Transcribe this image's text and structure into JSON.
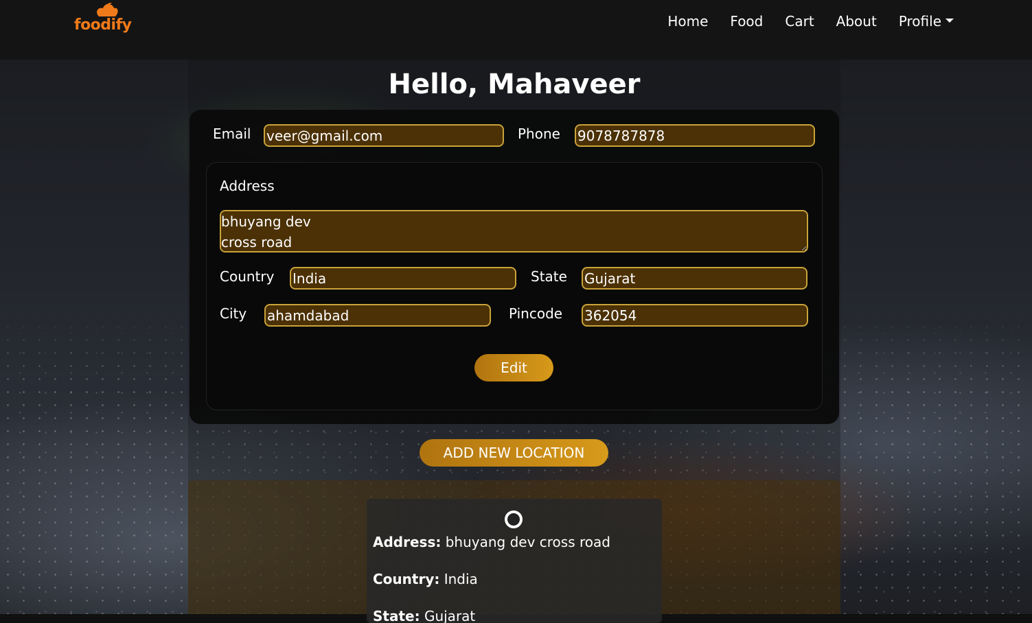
{
  "brand": {
    "logo_text": "foodify"
  },
  "nav": {
    "links": [
      "Home",
      "Food",
      "Cart",
      "About",
      "Profile"
    ]
  },
  "profile": {
    "greeting": "Hello, Mahaveer",
    "email_label": "Email",
    "email_value": "veer@gmail.com",
    "phone_label": "Phone",
    "phone_value": "9078787878",
    "address_label": "Address",
    "address_value": "bhuyang dev\ncross road",
    "country_label": "Country",
    "country_value": "India",
    "state_label": "State",
    "state_value": "Gujarat",
    "city_label": "City",
    "city_value": "ahamdabad",
    "pincode_label": "Pincode",
    "pincode_value": "362054",
    "edit_button": "Edit"
  },
  "add_location_button": "ADD NEW LOCATION",
  "locations": [
    {
      "address_label": "Address:",
      "address": "bhuyang dev cross road",
      "country_label": "Country:",
      "country": "India",
      "state_label": "State:",
      "state": "Gujarat"
    }
  ],
  "colors": {
    "accent": "#d89a1a",
    "logo": "#f07a1a",
    "field_bg": "#4b3105"
  }
}
